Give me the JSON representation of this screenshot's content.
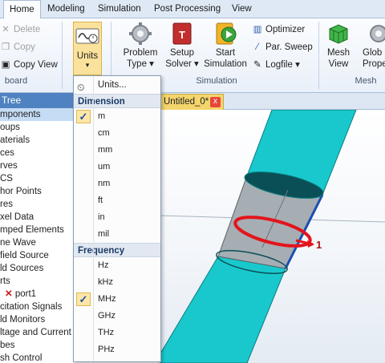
{
  "tabs": [
    "Home",
    "Modeling",
    "Simulation",
    "Post Processing",
    "View"
  ],
  "clipboard": {
    "delete": "Delete",
    "copy": "Copy",
    "copy_view": "Copy View",
    "group": "board"
  },
  "units_button": "Units",
  "simulation_group": {
    "problem_type": [
      "Problem",
      "Type"
    ],
    "setup_solver": [
      "Setup",
      "Solver"
    ],
    "start_simulation": [
      "Start",
      "Simulation"
    ],
    "optimizer": "Optimizer",
    "par_sweep": "Par. Sweep",
    "logfile": "Logfile",
    "label": "Simulation"
  },
  "mesh_group": {
    "mesh_view": [
      "Mesh",
      "View"
    ],
    "global_props": [
      "Glob",
      "Proper"
    ],
    "label": "Mesh"
  },
  "tree": {
    "header": "Tree",
    "items": [
      "mponents",
      "oups",
      "aterials",
      "ces",
      "rves",
      "CS",
      "hor Points",
      "res",
      "xel Data",
      "mped Elements",
      "ne Wave",
      "field Source",
      "ld Sources",
      "rts",
      "port1",
      "citation Signals",
      "ld Monitors",
      "ltage and Current M",
      "bes",
      "sh Control"
    ]
  },
  "doc_tab": {
    "label": "Untitled_0*",
    "close": "x"
  },
  "units_menu": {
    "top_item": "Units...",
    "dimension_header": "Dimension",
    "dimension_items": [
      "m",
      "cm",
      "mm",
      "um",
      "nm",
      "ft",
      "in",
      "mil"
    ],
    "dimension_selected": "m",
    "frequency_header": "Frequency",
    "frequency_items": [
      "Hz",
      "kHz",
      "MHz",
      "GHz",
      "THz",
      "PHz"
    ],
    "frequency_selected": "MHz"
  },
  "viewport": {
    "port_label": "1"
  },
  "colors": {
    "cylinder": "#19c8cc",
    "port_ring": "#e3141b",
    "port_edge": "#1a4fb0",
    "tree_header": "#4f82c0"
  }
}
